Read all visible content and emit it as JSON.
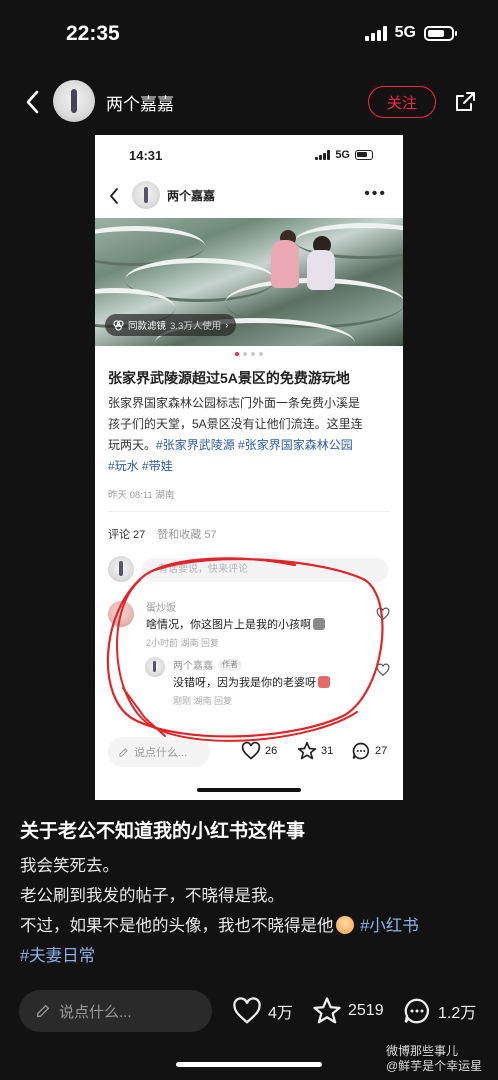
{
  "status_bar": {
    "time": "22:35",
    "network": "5G"
  },
  "header": {
    "author": "两个嘉嘉",
    "follow_label": "关注"
  },
  "embedded": {
    "status_time": "14:31",
    "status_network": "5G",
    "author": "两个嘉嘉",
    "filter_label": "同款滤镜",
    "filter_count": "3.3万人使用",
    "title": "张家界武陵源超过5A景区的免费游玩地",
    "body_line1": "张家界国家森林公园标志门外面一条免费小溪是",
    "body_line2": "孩子们的天堂，5A景区没有让他们流连。这里连",
    "body_line3_text": "玩两天。",
    "tags": [
      "#张家界武陵源",
      "#张家界国家森林公园",
      "#玩水",
      "#带娃"
    ],
    "date": "昨天 08:11 湖南",
    "comments_tab": "评论 27",
    "likes_tab": "赞和收藏 57",
    "comment_placeholder": "有话要说，快来评论",
    "comment1": {
      "name": "蛋炒饭",
      "text": "啥情况，你这图片上是我的小孩啊",
      "meta": "2小时前 湖南 回复"
    },
    "reply1": {
      "name": "两个嘉嘉",
      "badge": "作者",
      "text": "没错呀，因为我是你的老婆呀",
      "meta": "刚刚 湖南 回复"
    },
    "say_placeholder": "说点什么...",
    "likes": "26",
    "stars": "31",
    "comments": "27"
  },
  "caption": {
    "title": "关于老公不知道我的小红书这件事",
    "line1": "我会笑死去。",
    "line2": "老公刷到我发的帖子，不晓得是我。",
    "line3": "不过，如果不是他的头像，我也不晓得是他",
    "tag1": "#小红书",
    "tag2": "#夫妻日常"
  },
  "bottom_bar": {
    "say_placeholder": "说点什么...",
    "likes": "4万",
    "stars": "2519",
    "comments": "1.2万"
  },
  "watermark": {
    "line1": "微博那些事儿",
    "line2": "@鲜芋是个幸运星"
  },
  "colors": {
    "accent": "#ff2442",
    "tag": "#2f5e9e",
    "background": "#121212"
  }
}
